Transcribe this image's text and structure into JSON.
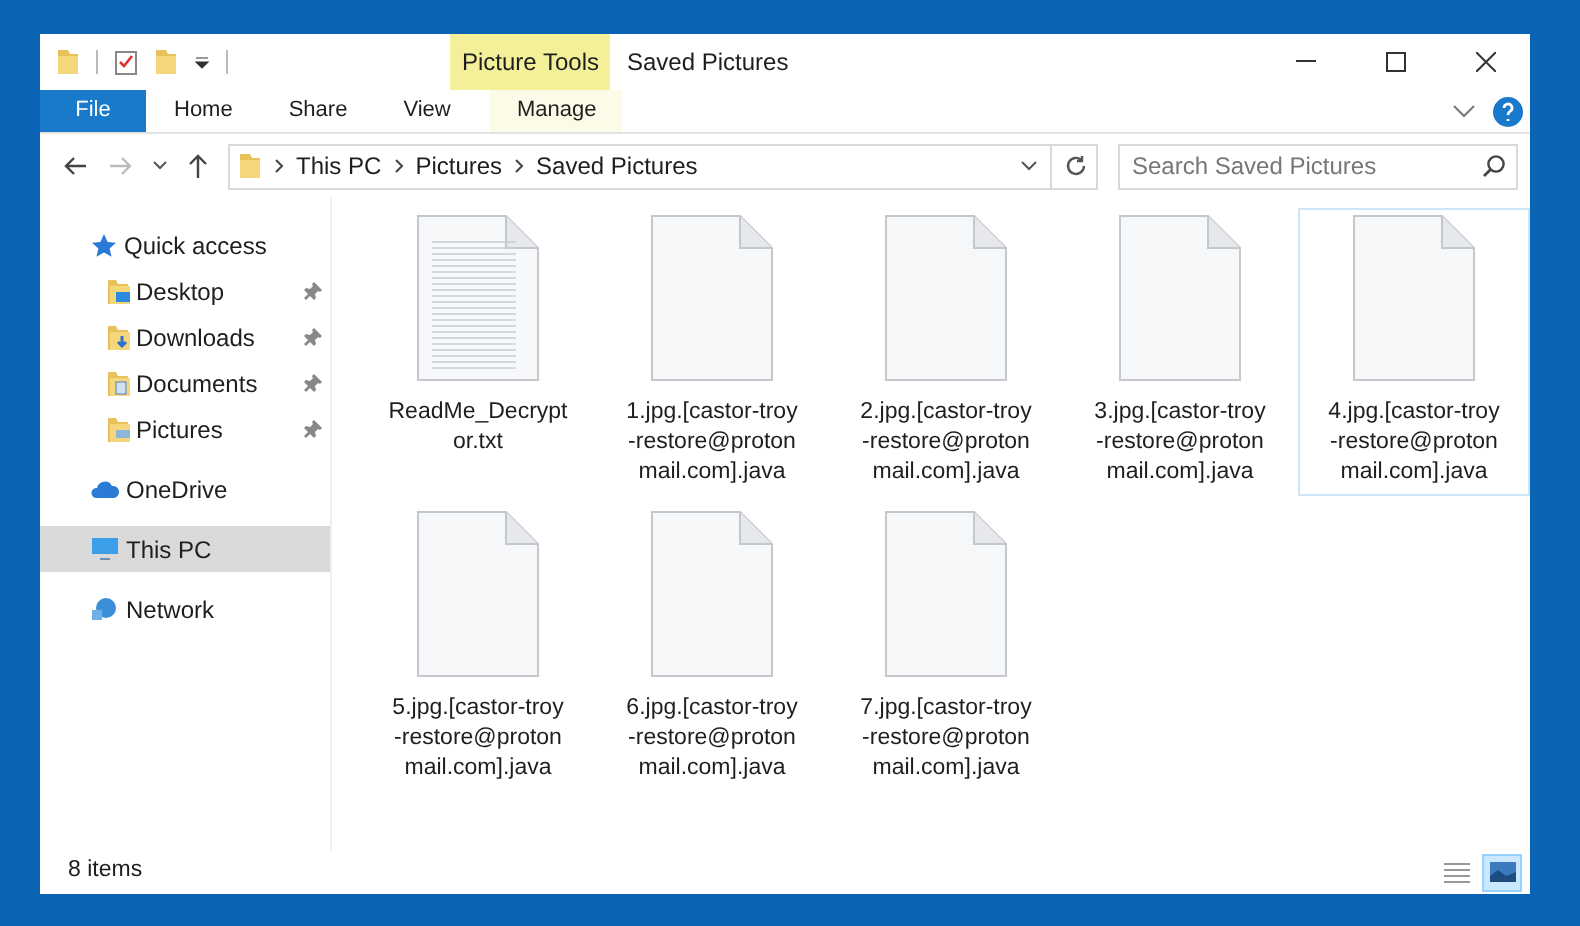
{
  "window": {
    "title": "Saved Pictures",
    "context_tab": "Picture Tools"
  },
  "ribbon_tabs": [
    {
      "label": "File",
      "kind": "file",
      "selected": false
    },
    {
      "label": "Home",
      "kind": "tab",
      "selected": false
    },
    {
      "label": "Share",
      "kind": "tab",
      "selected": false
    },
    {
      "label": "View",
      "kind": "tab",
      "selected": false
    },
    {
      "label": "Manage",
      "kind": "context",
      "selected": false
    }
  ],
  "address": {
    "path": [
      "This PC",
      "Pictures",
      "Saved Pictures"
    ]
  },
  "search": {
    "placeholder": "Search Saved Pictures"
  },
  "sidebar": {
    "items": [
      {
        "label": "Quick access",
        "kind": "quick",
        "selected": false,
        "children": [
          {
            "label": "Desktop",
            "kind": "desktop",
            "pinned": true,
            "selected": false
          },
          {
            "label": "Downloads",
            "kind": "downloads",
            "pinned": true,
            "selected": false
          },
          {
            "label": "Documents",
            "kind": "documents",
            "pinned": true,
            "selected": false
          },
          {
            "label": "Pictures",
            "kind": "pictures",
            "pinned": true,
            "selected": false
          }
        ]
      },
      {
        "label": "OneDrive",
        "kind": "cloud",
        "selected": false
      },
      {
        "label": "This PC",
        "kind": "pc",
        "selected": true
      },
      {
        "label": "Network",
        "kind": "network",
        "selected": false
      }
    ]
  },
  "files": [
    {
      "name_lines": [
        "ReadMe_Decrypt",
        "or.txt"
      ],
      "kind": "text",
      "highlighted": false
    },
    {
      "name_lines": [
        "1.jpg.[castor-troy",
        "-restore@proton",
        "mail.com].java"
      ],
      "kind": "blank",
      "highlighted": false
    },
    {
      "name_lines": [
        "2.jpg.[castor-troy",
        "-restore@proton",
        "mail.com].java"
      ],
      "kind": "blank",
      "highlighted": false
    },
    {
      "name_lines": [
        "3.jpg.[castor-troy",
        "-restore@proton",
        "mail.com].java"
      ],
      "kind": "blank",
      "highlighted": false
    },
    {
      "name_lines": [
        "4.jpg.[castor-troy",
        "-restore@proton",
        "mail.com].java"
      ],
      "kind": "blank",
      "highlighted": true
    },
    {
      "name_lines": [
        "5.jpg.[castor-troy",
        "-restore@proton",
        "mail.com].java"
      ],
      "kind": "blank",
      "highlighted": false
    },
    {
      "name_lines": [
        "6.jpg.[castor-troy",
        "-restore@proton",
        "mail.com].java"
      ],
      "kind": "blank",
      "highlighted": false
    },
    {
      "name_lines": [
        "7.jpg.[castor-troy",
        "-restore@proton",
        "mail.com].java"
      ],
      "kind": "blank",
      "highlighted": false
    }
  ],
  "status_bar": {
    "count": "8 items",
    "views": [
      {
        "kind": "details",
        "selected": false
      },
      {
        "kind": "large-icons",
        "selected": true
      }
    ]
  }
}
